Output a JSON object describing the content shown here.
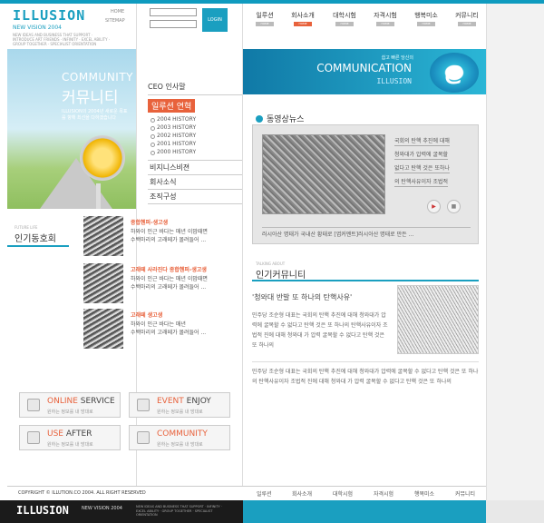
{
  "brand": {
    "logo": "ILLUSION",
    "sub": "NEW VISION 2004",
    "tagline": "NEW IDEAS AND BUSINESS THAT SUPPORT · INTRODUCE ART FRIENDS · INFINITY · EXCEL ABILITY · GROUP TOGETHER · SPECIALIST ORIENTATION",
    "home": "HOME",
    "sitemap": "SITEMAP"
  },
  "login": {
    "button": "LOGIN"
  },
  "menu": [
    {
      "ko": "일루션",
      "en": "HOME",
      "active": false
    },
    {
      "ko": "회사소개",
      "en": "HOME",
      "active": true
    },
    {
      "ko": "대학시험",
      "en": "HOME",
      "active": false
    },
    {
      "ko": "자격시험",
      "en": "HOME",
      "active": false
    },
    {
      "ko": "행복미소",
      "en": "HOME",
      "active": false
    },
    {
      "ko": "커뮤니티",
      "en": "HOME",
      "active": false
    }
  ],
  "community": {
    "en": "COMMUNITY",
    "ko": "커뮤니티",
    "desc": "ILLUSION의 2004년 새로운 목표를 향해 최선을 다하겠습니다"
  },
  "submenu": {
    "head": "CEO 인사말",
    "active": "일루션 연혁",
    "history": [
      "2004 HISTORY",
      "2003 HISTORY",
      "2002 HISTORY",
      "2001 HISTORY",
      "2000 HISTORY"
    ],
    "items": [
      "비지니스비젼",
      "회사소식",
      "조직구성"
    ]
  },
  "banner": {
    "sub": "쉽고 빠른 당신의",
    "title": "COMMUNICATION",
    "logo": "ILLUSION",
    "icon": "e"
  },
  "news": {
    "title": "동영상뉴스",
    "lines": [
      "국회의 탄핵 추진에 대해",
      "청와대가 압력에 굴복할",
      "없다고 탄핵 것은 또하나",
      "의 탄핵사유이자 조법적"
    ],
    "caption": "러시아산 명태가 국내산 황태로 [엽커멘트]러시아산 명태로 만든 ..."
  },
  "popular_club": {
    "small": "FUTURE LIFE",
    "title": "인기동호회",
    "items": [
      {
        "cat": "종합헨퍼-생고생",
        "text1": "하와이 인근 바다는 매년 이맘때면",
        "text2": "수백마리의 고래떼가 몰려들어 ..."
      },
      {
        "cat": "고래떼 사라진다 종합헨퍼-생고생",
        "text1": "하와이 인근 바다는 매년 이맘때면",
        "text2": "수백마리의 고래떼가 몰려들어 ..."
      },
      {
        "cat": "고래떼 생고생",
        "text1": "하와이 인근 바다는 매년",
        "text2": "수백마리의 고래떼가 몰려들어 ..."
      }
    ]
  },
  "popular_community": {
    "small": "TALKING ABOUT",
    "title": "인기커뮤니티",
    "head": "'청와대 반발 또 하나의 탄핵사유'",
    "body1": "민주당 조순형 대표는 국회의 탄핵 추진에 대해 청와대가 압력에 굴복할 수 없다고 탄핵 것은 또 하나의 탄핵사유이자 조법적 진에 대해 청와대 가 압력 굴복할 수 없다고 탄핵 것은 또 하나의",
    "body2": "민주당 조순형 대표는 국회의 탄핵 추진에 대해 청와대가 압력에 굴복할 수 없다고 탄핵 것은 또 하나의 탄핵사유이자 조법적 진에 대해 청와대 가 압력 굴복할 수 없다고 탄핵 것은 또 하나의"
  },
  "quick": [
    {
      "title_a": "ONLINE",
      "title_b": "SERVICE",
      "sub": "원하는 정보를 내 방대로"
    },
    {
      "title_a": "EVENT",
      "title_b": "ENJOY",
      "sub": "원하는 정보를 내 방대로"
    },
    {
      "title_a": "USE",
      "title_b": "AFTER",
      "sub": "원하는 정보를 내 방대로"
    },
    {
      "title_a": "COMMUNITY",
      "title_b": "",
      "sub": "원하는 정보를 내 방대로"
    }
  ],
  "footer": {
    "copyright": "COPYRIGHT © ILLUTION.CO 2004. ALL RIGHT RESERVED",
    "menu": [
      "일루션",
      "회사소개",
      "대학시험",
      "자격시험",
      "행복미소",
      "커뮤니티"
    ],
    "logo": "ILLUSION",
    "logo_sub": "NEW VISION 2004",
    "tagline": "NEW IDEAS AND BUSINESS THAT SUPPORT · INFINITY · EXCEL ABILITY · GROUP TOGETHER · SPECIALIST ORIENTATION"
  },
  "colors": {
    "accent": "#1a9fc0",
    "highlight": "#e8623c",
    "dark": "#1b1b1b"
  }
}
